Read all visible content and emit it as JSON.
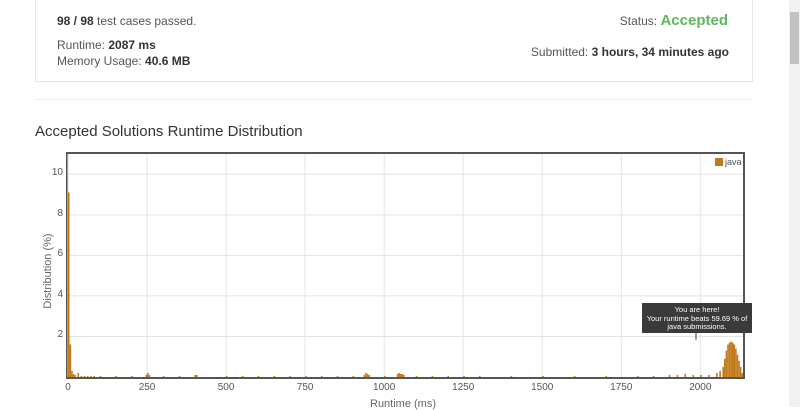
{
  "submission": {
    "tests_passed": "98 / 98",
    "tests_suffix": "test cases passed.",
    "runtime_label": "Runtime:",
    "runtime_value": "2087 ms",
    "memory_label": "Memory Usage:",
    "memory_value": "40.6 MB",
    "status_label": "Status:",
    "status_value": "Accepted",
    "submitted_label": "Submitted:",
    "submitted_value": "3 hours, 34 minutes ago"
  },
  "section_title": "Accepted Solutions Runtime Distribution",
  "chart_data": {
    "type": "bar",
    "title": "",
    "xlabel": "Runtime (ms)",
    "ylabel": "Distribution (%)",
    "xlim": [
      0,
      2135
    ],
    "ylim": [
      0,
      11
    ],
    "xticks": [
      0,
      250,
      500,
      750,
      1000,
      1250,
      1500,
      1750,
      2000
    ],
    "yticks": [
      2,
      4,
      6,
      8,
      10
    ],
    "grid": true,
    "legend_position": "top-right",
    "series": [
      {
        "name": "java",
        "color": "#c27a1b",
        "bin_width": 5,
        "x": [
          0,
          5,
          10,
          15,
          20,
          30,
          40,
          50,
          60,
          70,
          80,
          100,
          150,
          200,
          245,
          250,
          255,
          300,
          350,
          400,
          405,
          500,
          550,
          600,
          650,
          700,
          750,
          800,
          850,
          900,
          935,
          940,
          945,
          950,
          1000,
          1040,
          1045,
          1050,
          1055,
          1060,
          1100,
          1150,
          1200,
          1250,
          1300,
          1400,
          1500,
          1600,
          1700,
          1800,
          1850,
          1900,
          1925,
          1950,
          1975,
          2000,
          2025,
          2050,
          2060,
          2070,
          2075,
          2080,
          2085,
          2090,
          2095,
          2100,
          2105,
          2110,
          2115,
          2120,
          2125,
          2130
        ],
        "values": [
          9.1,
          1.6,
          0.3,
          0.15,
          0.1,
          0.2,
          0.05,
          0.05,
          0.05,
          0.05,
          0.05,
          0.05,
          0.05,
          0.05,
          0.1,
          0.2,
          0.1,
          0.05,
          0.05,
          0.1,
          0.1,
          0.05,
          0.05,
          0.05,
          0.05,
          0.05,
          0.05,
          0.05,
          0.05,
          0.05,
          0.1,
          0.2,
          0.15,
          0.1,
          0.05,
          0.15,
          0.2,
          0.15,
          0.15,
          0.1,
          0.05,
          0.05,
          0.05,
          0.05,
          0.05,
          0.05,
          0.05,
          0.05,
          0.05,
          0.05,
          0.05,
          0.1,
          0.1,
          0.15,
          0.1,
          0.1,
          0.1,
          0.2,
          0.3,
          0.5,
          0.9,
          1.3,
          1.6,
          1.7,
          1.75,
          1.7,
          1.6,
          1.4,
          1.1,
          0.8,
          0.5,
          0.2
        ]
      }
    ],
    "tooltip": {
      "line1": "You are here!",
      "line2": "Your runtime beats 59.69 % of",
      "line3": "java submissions."
    }
  }
}
